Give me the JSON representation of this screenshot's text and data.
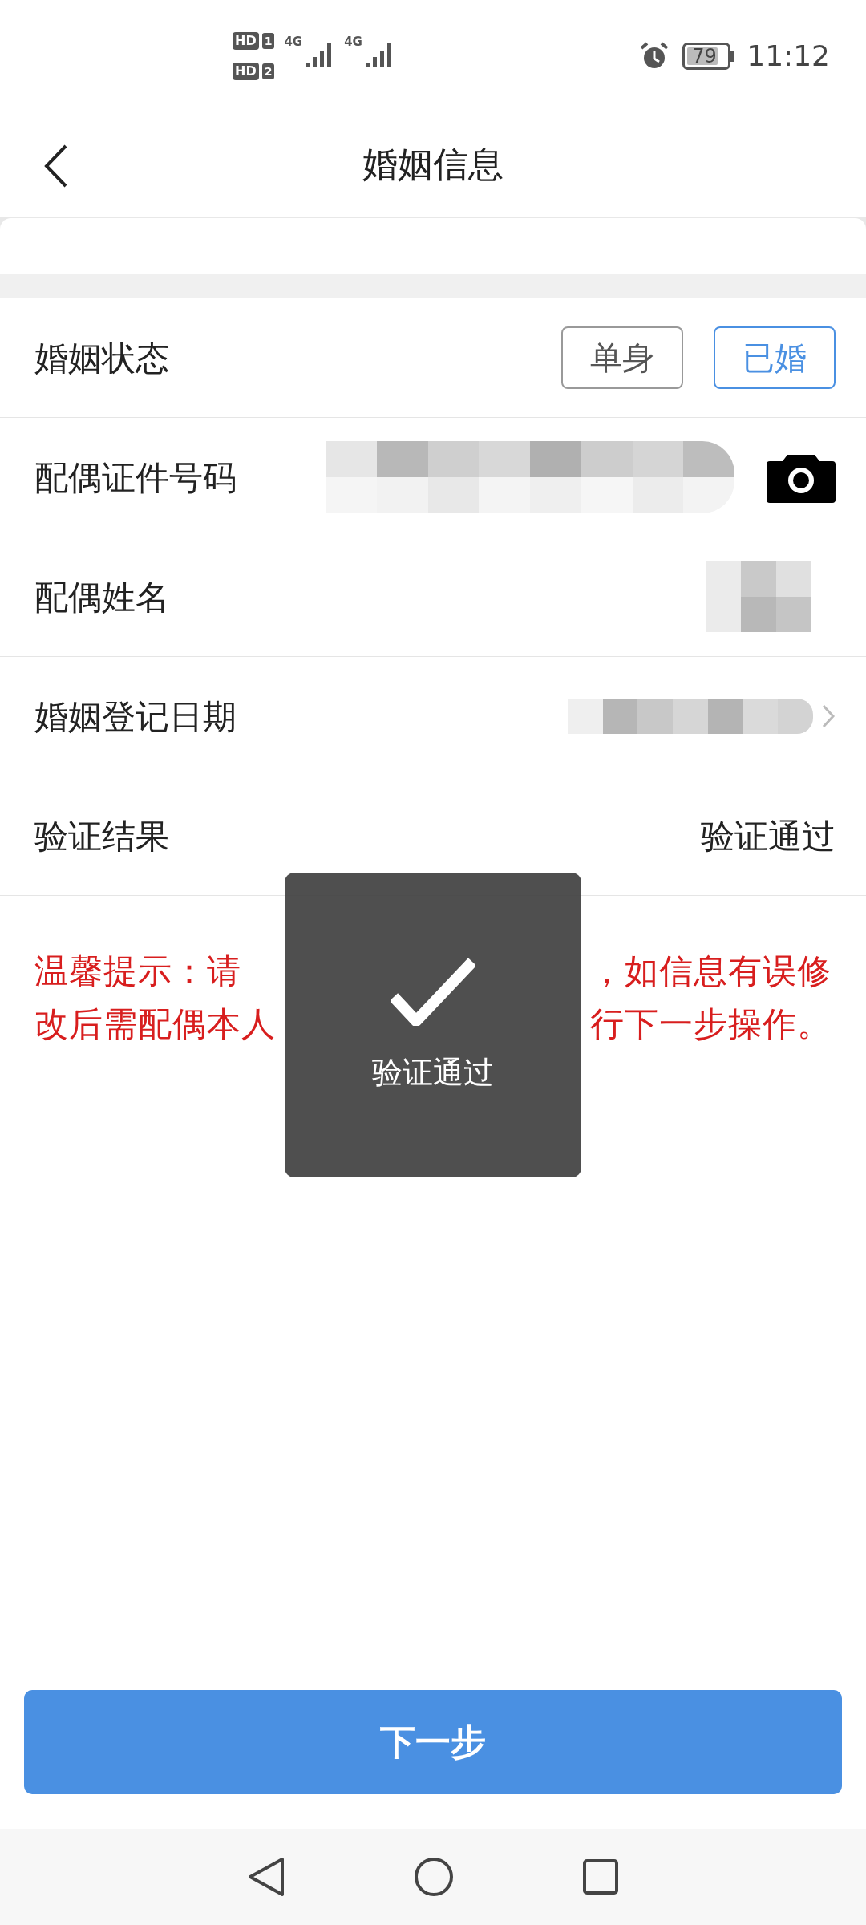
{
  "status_bar": {
    "sims": [
      {
        "badge": "HD",
        "slot": "1",
        "network": "4G"
      },
      {
        "badge": "HD",
        "slot": "2",
        "network": "4G"
      }
    ],
    "battery": "79",
    "time": "11:12"
  },
  "header": {
    "title": "婚姻信息"
  },
  "rows": [
    {
      "kind": "choice",
      "label": "婚姻状态",
      "options": [
        {
          "label": "单身",
          "selected": false
        },
        {
          "label": "已婚",
          "selected": true
        }
      ]
    },
    {
      "kind": "redacted_camera",
      "label": "配偶证件号码"
    },
    {
      "kind": "redacted",
      "label": "配偶姓名"
    },
    {
      "kind": "redacted_arrow",
      "label": "婚姻登记日期"
    },
    {
      "kind": "text",
      "label": "验证结果",
      "value": "验证通过"
    }
  ],
  "notice": {
    "lines": [
      {
        "left": "温馨提示：请",
        "right": "，如信息有误修"
      },
      {
        "left": "改后需配偶本人",
        "right": "行下一步操作。"
      }
    ]
  },
  "toast": {
    "message": "验证通过"
  },
  "next_button": "下一步"
}
